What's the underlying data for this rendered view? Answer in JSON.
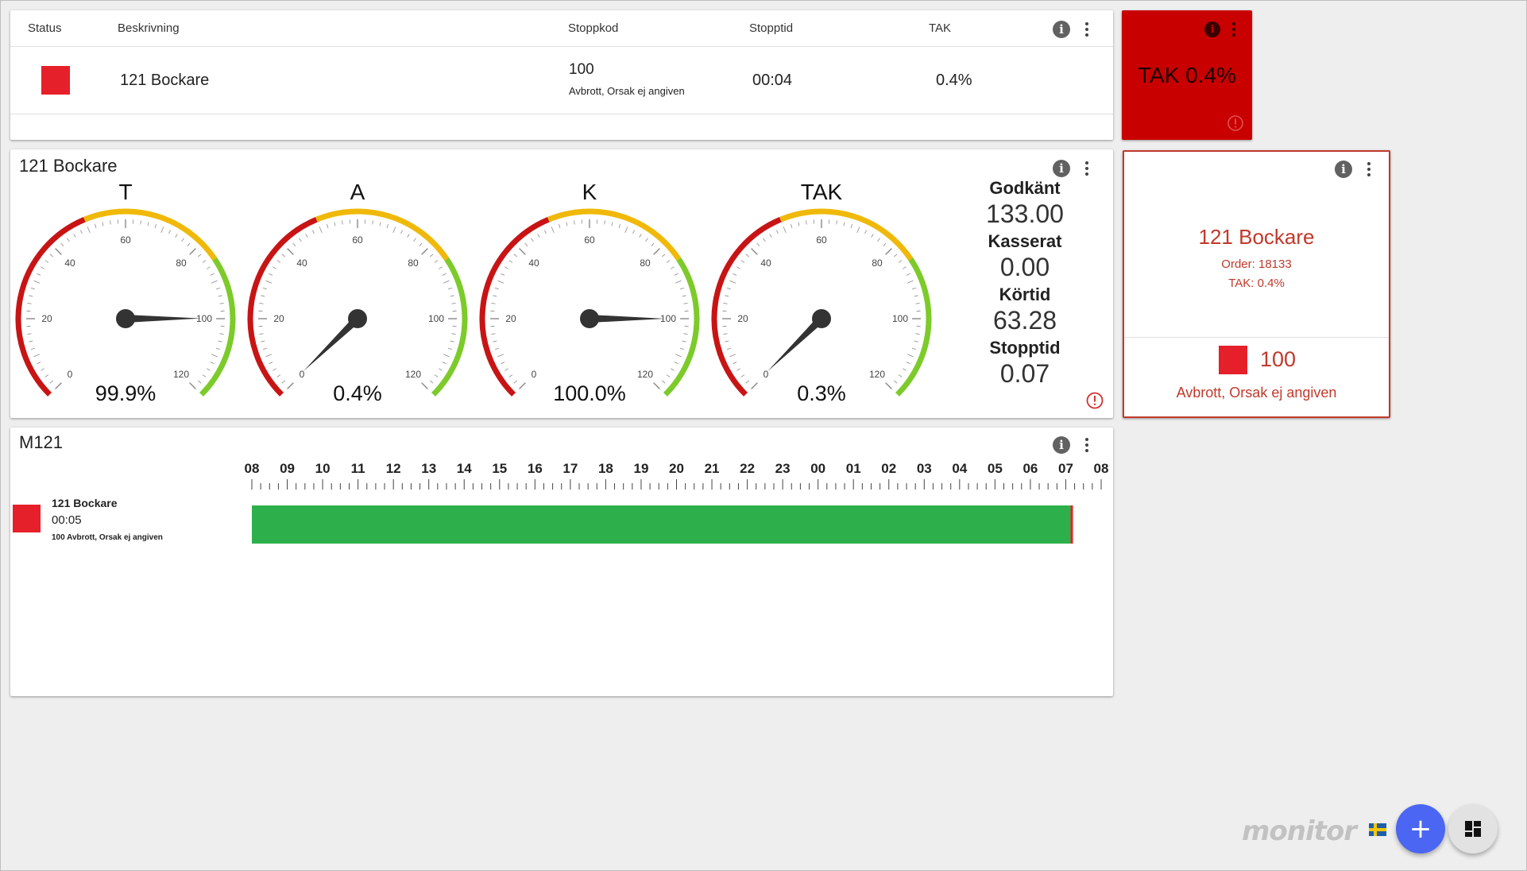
{
  "status_table": {
    "headers": [
      "Status",
      "Beskrivning",
      "Stoppkod",
      "Stopptid",
      "TAK"
    ],
    "row": {
      "description": "121 Bockare",
      "stop_code": "100",
      "stop_reason": "Avbrott, Orsak ej angiven",
      "stop_time": "00:04",
      "tak": "0.4%",
      "status_color": "#e6202a"
    }
  },
  "tak_alarm": {
    "text": "TAK 0.4%",
    "background": "#c80000"
  },
  "gauges_card": {
    "title": "121 Bockare",
    "scale": [
      "0",
      "20",
      "40",
      "60",
      "80",
      "100",
      "120"
    ],
    "gauges": [
      {
        "label": "T",
        "value": 99.9,
        "display": "99.9%"
      },
      {
        "label": "A",
        "value": 0.4,
        "display": "0.4%"
      },
      {
        "label": "K",
        "value": 100.0,
        "display": "100.0%"
      },
      {
        "label": "TAK",
        "value": 0.3,
        "display": "0.3%"
      }
    ],
    "stats": [
      {
        "label": "Godkänt",
        "value": "133.00"
      },
      {
        "label": "Kasserat",
        "value": "0.00"
      },
      {
        "label": "Körtid",
        "value": "63.28"
      },
      {
        "label": "Stopptid",
        "value": "0.07"
      }
    ]
  },
  "machine_card": {
    "title": "121 Bockare",
    "order": "Order: 18133",
    "tak": "TAK: 0.4%",
    "stop_code": "100",
    "stop_reason": "Avbrott, Orsak ej angiven",
    "accent": "#c0392b"
  },
  "timeline": {
    "title": "M121",
    "hours": [
      "08",
      "09",
      "10",
      "11",
      "12",
      "13",
      "14",
      "15",
      "16",
      "17",
      "18",
      "19",
      "20",
      "21",
      "22",
      "23",
      "00",
      "01",
      "02",
      "03",
      "04",
      "05",
      "06",
      "07",
      "08"
    ],
    "entry": {
      "name": "121 Bockare",
      "time": "00:05",
      "reason": "100 Avbrott, Orsak ej angiven"
    },
    "run_fraction": 0.964,
    "run_color": "#2db04b",
    "stop_color": "#e6202a"
  },
  "footer": {
    "logo": "monitor",
    "add_label": "+"
  }
}
